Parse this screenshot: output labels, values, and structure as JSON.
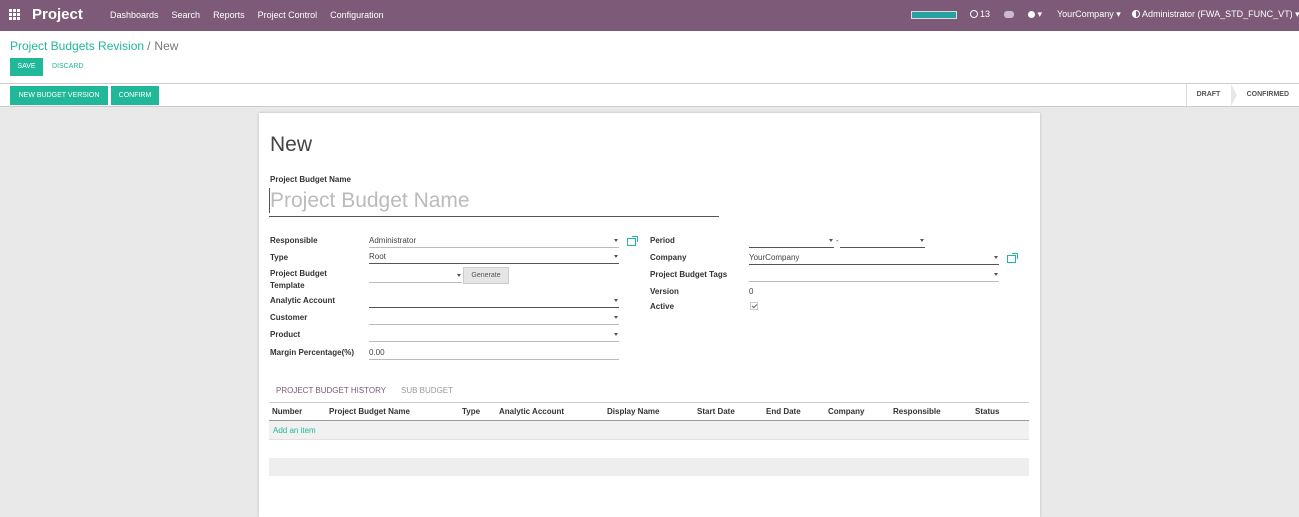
{
  "navbar": {
    "app_name": "Project",
    "menu": [
      "Dashboards",
      "Search",
      "Reports",
      "Project Control",
      "Configuration"
    ],
    "progress": 1.0,
    "notifications_count": "13",
    "company": "YourCompany ▾",
    "user": "Administrator (FWA_STD_FUNC_VT) ▾",
    "bug_caret": "▾"
  },
  "breadcrumb": {
    "parent": "Project Budgets Revision",
    "separator": "/",
    "current": "New"
  },
  "buttons": {
    "save": "Save",
    "discard": "Discard",
    "new_budget_version": "New Budget Version",
    "confirm": "Confirm",
    "generate": "Generate"
  },
  "states": [
    "Draft",
    "Confirmed"
  ],
  "form": {
    "title": "New",
    "name_label": "Project Budget Name",
    "name_placeholder": "Project Budget Name",
    "left": {
      "responsible_label": "Responsible",
      "responsible_value": "Administrator",
      "type_label": "Type",
      "type_value": "Root",
      "template_label_1": "Project Budget",
      "template_label_2": "Template",
      "analytic_label": "Analytic Account",
      "customer_label": "Customer",
      "product_label": "Product",
      "margin_label": "Margin Percentage(%)",
      "margin_value": "0.00"
    },
    "right": {
      "period_label": "Period",
      "period_sep": "-",
      "company_label": "Company",
      "company_value": "YourCompany",
      "tags_label": "Project Budget Tags",
      "version_label": "Version",
      "version_value": "0",
      "active_label": "Active",
      "active_checked": true
    }
  },
  "notebook": {
    "tabs": [
      "Project Budget History",
      "Sub Budget"
    ],
    "columns": [
      "Number",
      "Project Budget Name",
      "Type",
      "Analytic Account",
      "Display Name",
      "Start Date",
      "End Date",
      "Company",
      "Responsible",
      "Status"
    ],
    "add_item": "Add an item"
  },
  "colors": {
    "navbar": "#7c5a78",
    "primary": "#21b799"
  }
}
